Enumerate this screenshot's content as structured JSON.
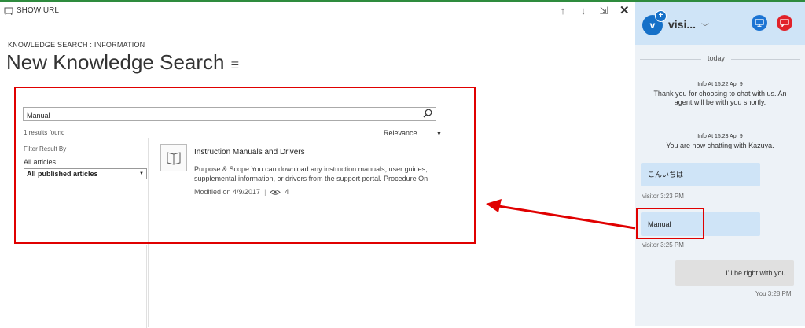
{
  "toolbar": {
    "show_url_label": "SHOW URL",
    "icons": [
      "arrow-up-icon",
      "arrow-down-icon",
      "popout-icon",
      "close-icon"
    ]
  },
  "page": {
    "breadcrumb": "KNOWLEDGE SEARCH : INFORMATION",
    "title": "New Knowledge Search"
  },
  "search": {
    "query": "Manual",
    "results_count": "1 results found",
    "sort_label": "Relevance",
    "filter_label": "Filter Result By",
    "filter_value": "All articles",
    "filter_select": "All published articles"
  },
  "article": {
    "title": "Instruction Manuals and Drivers",
    "description": "Purpose & Scope You can download any instruction manuals, user guides, supplemental information, or drivers from the support portal. Procedure On",
    "modified": "Modified on 4/9/2017",
    "views": "4"
  },
  "chat": {
    "avatar_letter": "v",
    "visitor_name": "visi...",
    "day_separator": "today",
    "messages": [
      {
        "header": "Info At 15:22 Apr 9",
        "text": "Thank you for choosing to chat with us. An agent will be with you shortly."
      },
      {
        "header": "Info At 15:23 Apr 9",
        "text": "You are now chatting with Kazuya."
      }
    ],
    "visitor_messages": [
      {
        "text": "こんいちは",
        "stamp": "visitor 3:23 PM"
      },
      {
        "text": "Manual",
        "stamp": "visitor 3:25 PM"
      }
    ],
    "agent_messages": [
      {
        "text": "I'll be right with you.",
        "stamp": "You 3:28 PM"
      }
    ]
  },
  "colors": {
    "highlight": "#e00000",
    "chat_header": "#cfe4f7",
    "chat_bg": "#edf2f7",
    "accent_blue": "#1c74d3",
    "accent_red": "#e1222a"
  }
}
